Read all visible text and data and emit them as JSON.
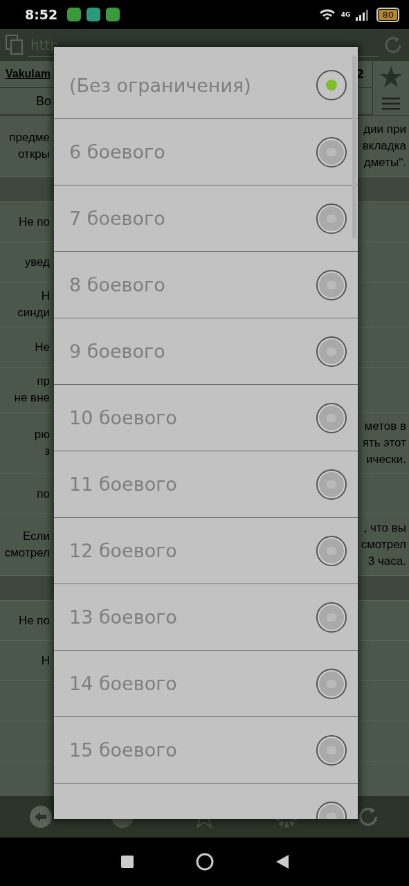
{
  "status_bar": {
    "time": "8:52",
    "network": "4G",
    "battery": "80"
  },
  "address_bar": {
    "url": "http"
  },
  "header": {
    "link": "Vakulam",
    "number": "2",
    "subtitle": "Во"
  },
  "rows": [
    {
      "kind": "text",
      "left": [
        "предме",
        "откры"
      ],
      "right": [
        "дии при",
        "вкладка",
        "дметы\"."
      ]
    },
    {
      "kind": "section"
    },
    {
      "kind": "text",
      "left": [
        "Не по"
      ]
    },
    {
      "kind": "text",
      "left": [
        "увед"
      ]
    },
    {
      "kind": "text",
      "left": [
        "Н",
        "синди"
      ]
    },
    {
      "kind": "text",
      "left": [
        "Не"
      ]
    },
    {
      "kind": "text",
      "left": [
        "пр",
        "не вне"
      ]
    },
    {
      "kind": "text",
      "left": [
        "рю",
        "з"
      ],
      "right": [
        "метов в",
        "ять этот",
        "ически."
      ]
    },
    {
      "kind": "text",
      "left": [
        "по"
      ]
    },
    {
      "kind": "text",
      "left": [
        "Если",
        "смотрел"
      ],
      "right": [
        ", что вы",
        "смотрел",
        "3 часа."
      ]
    },
    {
      "kind": "section"
    },
    {
      "kind": "text",
      "left": [
        "Не по"
      ]
    },
    {
      "kind": "text",
      "left": [
        "Н"
      ]
    },
    {
      "kind": "text"
    },
    {
      "kind": "text"
    }
  ],
  "dialog": {
    "options": [
      {
        "label": "(Без ограничения)",
        "selected": true
      },
      {
        "label": "6 боевого",
        "selected": false
      },
      {
        "label": "7 боевого",
        "selected": false
      },
      {
        "label": "8 боевого",
        "selected": false
      },
      {
        "label": "9 боевого",
        "selected": false
      },
      {
        "label": "10 боевого",
        "selected": false
      },
      {
        "label": "11 боевого",
        "selected": false
      },
      {
        "label": "12 боевого",
        "selected": false
      },
      {
        "label": "13 боевого",
        "selected": false
      },
      {
        "label": "14 боевого",
        "selected": false
      },
      {
        "label": "15 боевого",
        "selected": false
      },
      {
        "selected": false
      }
    ]
  }
}
